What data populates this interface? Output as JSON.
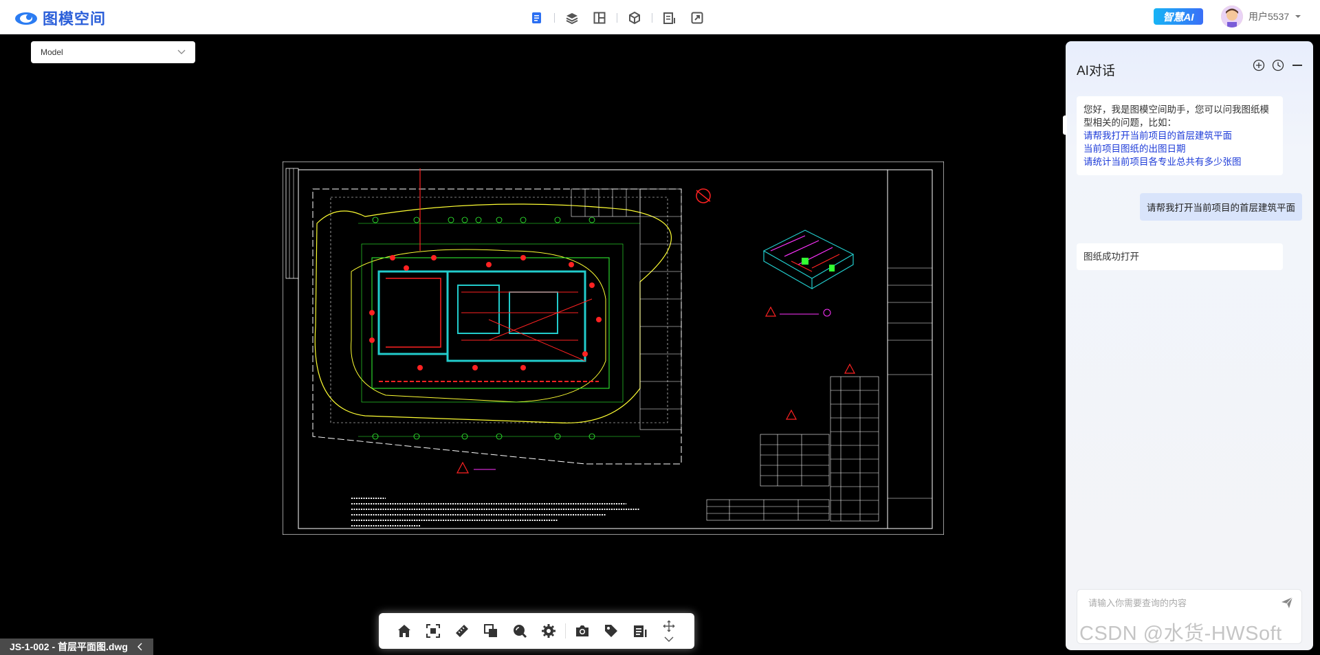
{
  "app": {
    "logo_text": "图模空间",
    "ai_badge": "智慧AI",
    "user_name": "用户5537"
  },
  "toolbar_top": {
    "icons": [
      "document-icon",
      "layers-icon",
      "grid-panel-icon",
      "cube-icon",
      "list-icon",
      "expand-icon"
    ]
  },
  "viewer": {
    "layout_select": "Model",
    "file_tab": "JS-1-002 - 首层平面图.dwg"
  },
  "bottom_toolbar": {
    "icons": [
      "home-icon",
      "fit-view-icon",
      "measure-icon",
      "compare-icon",
      "search-zoom-icon",
      "settings-icon",
      "camera-icon",
      "tag-icon",
      "list-icon",
      "pan-icon",
      "chevron-down-icon"
    ]
  },
  "ai_panel": {
    "title": "AI对话",
    "greeting": "您好，我是图模空间助手，您可以问我图纸模型相关的问题，比如：",
    "suggestions": [
      "请帮我打开当前项目的首层建筑平面",
      "当前项目图纸的出图日期",
      "请统计当前项目各专业总共有多少张图"
    ],
    "user_message": "请帮我打开当前项目的首层建筑平面",
    "ai_reply": "图纸成功打开",
    "input_placeholder": "请输入你需要查询的内容"
  },
  "watermark": "CSDN @水货-HWSoft",
  "colors": {
    "brand": "#2b5fd9",
    "link": "#1d3bd8",
    "user_bubble": "#d9e4fb",
    "canvas": "#000000"
  }
}
